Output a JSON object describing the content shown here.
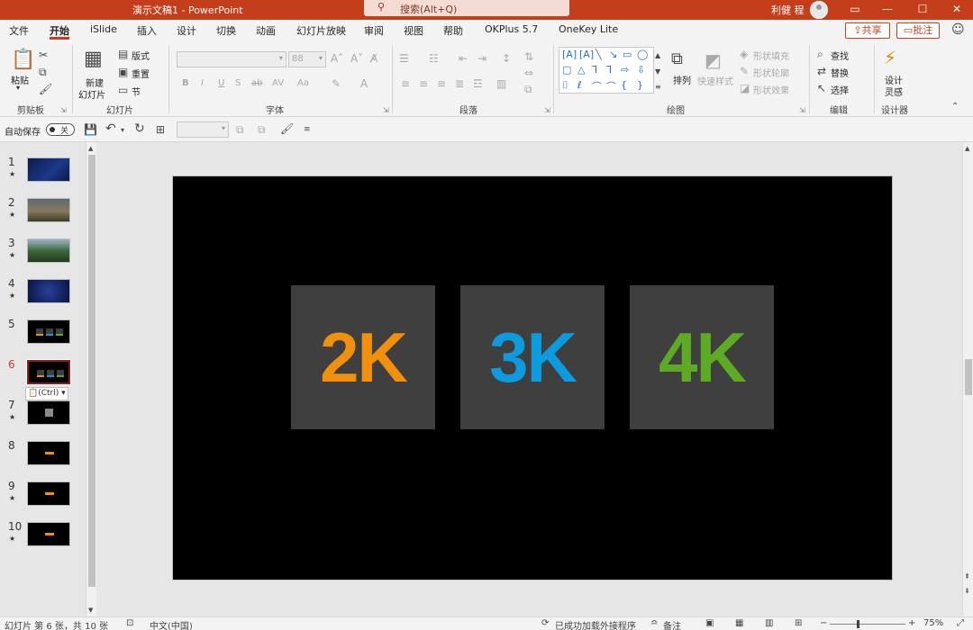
{
  "title_bar": {
    "doc_title": "演示文稿1  -  PowerPoint",
    "search_placeholder": "搜索(Alt+Q)",
    "user_name": "利健 程"
  },
  "menu": {
    "tabs": [
      "文件",
      "开始",
      "iSlide",
      "插入",
      "设计",
      "切换",
      "动画",
      "幻灯片放映",
      "审阅",
      "视图",
      "帮助",
      "OKPlus 5.7",
      "OneKey Lite"
    ],
    "active_tab": "开始",
    "share_label": "共享",
    "comment_label": "批注"
  },
  "ribbon": {
    "clipboard": {
      "paste": "粘贴",
      "group": "剪贴板"
    },
    "slides": {
      "new_slide_line1": "新建",
      "new_slide_line2": "幻灯片",
      "layout": "版式",
      "reset": "重置",
      "section": "节",
      "group": "幻灯片"
    },
    "font": {
      "size_value": "88",
      "bold": "B",
      "italic": "I",
      "underline": "U",
      "shadow": "S",
      "strike": "ab",
      "group": "字体"
    },
    "paragraph": {
      "group": "段落"
    },
    "drawing": {
      "arrange": "排列",
      "quick_styles": "快速样式",
      "shape_fill": "形状填充",
      "shape_outline": "形状轮廓",
      "shape_effects": "形状效果",
      "group": "绘图"
    },
    "editing": {
      "find": "查找",
      "replace": "替换",
      "select": "选择",
      "group": "编辑"
    },
    "designer": {
      "line1": "设计",
      "line2": "灵感",
      "group": "设计器"
    }
  },
  "qat": {
    "autosave_label": "自动保存",
    "autosave_state": "关"
  },
  "thumbnails": [
    {
      "num": "1",
      "star": "★"
    },
    {
      "num": "2",
      "star": "★"
    },
    {
      "num": "3",
      "star": "★"
    },
    {
      "num": "4",
      "star": "★"
    },
    {
      "num": "5",
      "star": ""
    },
    {
      "num": "6",
      "star": ""
    },
    {
      "num": "7",
      "star": "★"
    },
    {
      "num": "8",
      "star": ""
    },
    {
      "num": "9",
      "star": "★"
    },
    {
      "num": "10",
      "star": "★"
    }
  ],
  "selected_slide": "6",
  "paste_options_label": "(Ctrl)",
  "slide": {
    "boxes": [
      {
        "label": "2K",
        "color": "#f0900c"
      },
      {
        "label": "3K",
        "color": "#0d9be0"
      },
      {
        "label": "4K",
        "color": "#5dab24"
      }
    ],
    "box_color": "#3f3f3f",
    "background": "#000000"
  },
  "status": {
    "slide_info": "幻灯片 第 6 张，共 10 张",
    "language": "中文(中国)",
    "addins": "已成功加载外接程序",
    "notes": "备注",
    "zoom": "75%"
  },
  "colors": {
    "accent": "#c43e1c"
  }
}
